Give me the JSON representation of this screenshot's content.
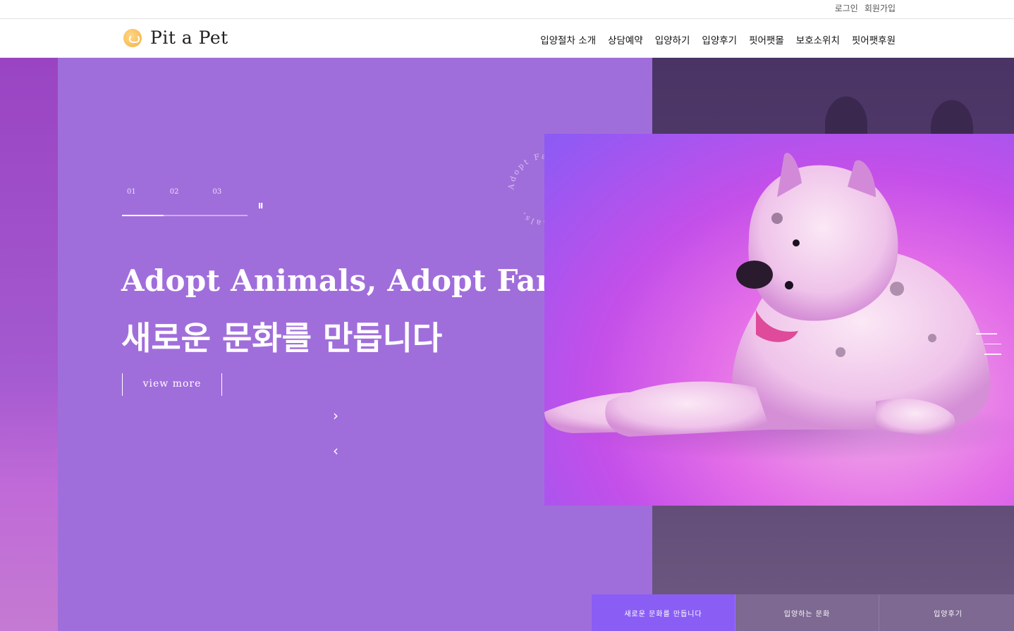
{
  "topbar": {
    "login": "로그인",
    "signup": "회원가입"
  },
  "header": {
    "logo_text": "Pit a Pet",
    "nav": [
      "입양절차 소개",
      "상담예약",
      "입양하기",
      "입양후기",
      "핏어팻몰",
      "보호소위치",
      "핏어팻후원"
    ]
  },
  "hero": {
    "circle_text": "Adopt Family Adopt Animals,",
    "slides": [
      "01",
      "02",
      "03"
    ],
    "progress": 0.33,
    "pause_label": "II",
    "headline_en": "Adopt Animals, Adopt Family",
    "headline_ko": "새로운 문화를 만듭니다",
    "view_more": "view more",
    "next_arrow": "›",
    "prev_arrow": "‹"
  },
  "bottom_tabs": [
    "새로운 문화를 만듭니다",
    "입양하는 문화",
    "입양후기"
  ],
  "colors": {
    "hero_purple": "#a06edb",
    "active_tab": "#8a5ef4",
    "dark_panel": "#4a3465"
  }
}
